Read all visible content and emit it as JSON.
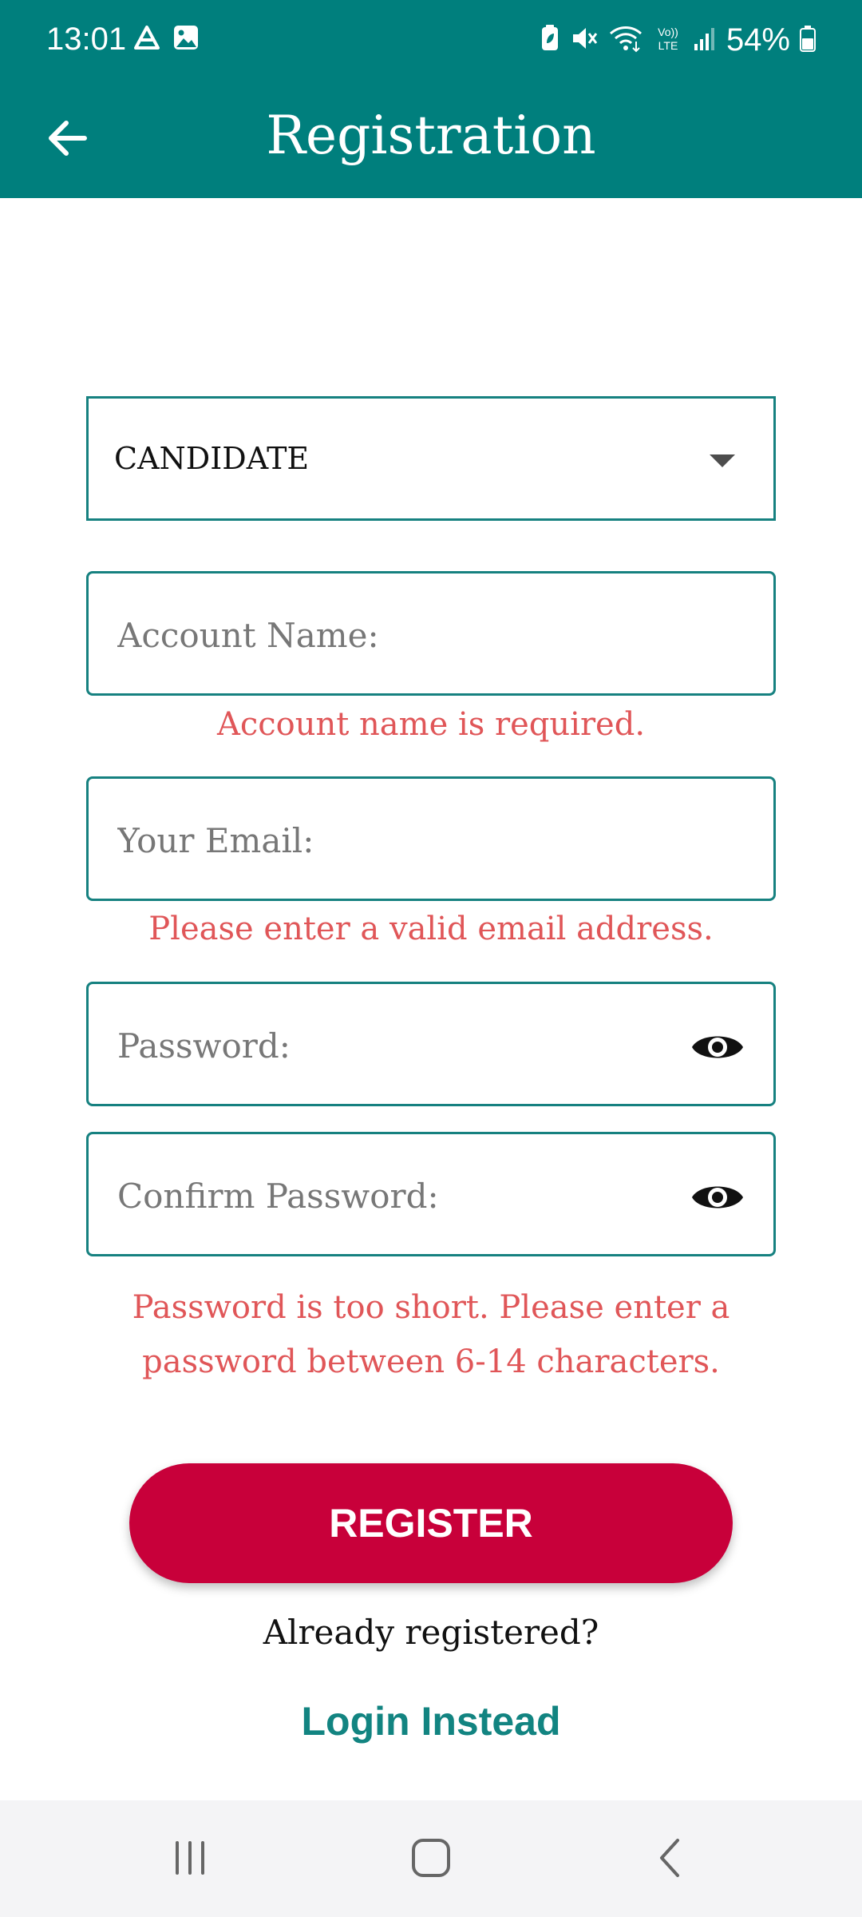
{
  "status_bar": {
    "time": "13:01",
    "battery": "54%",
    "icons": [
      "drive-icon",
      "image-icon",
      "battery-saver-icon",
      "mute-icon",
      "wifi-icon",
      "volte-icon",
      "signal-icon",
      "battery-icon"
    ]
  },
  "app_bar": {
    "title": "Registration",
    "back_icon": "back-arrow-icon"
  },
  "form": {
    "account_type": {
      "value": "CANDIDATE",
      "icon": "dropdown-caret-icon"
    },
    "account_name": {
      "placeholder": "Account Name:",
      "error": "Account name is required."
    },
    "email": {
      "placeholder": "Your Email:",
      "error": "Please enter a valid email address."
    },
    "password": {
      "placeholder": "Password:",
      "icon": "eye-icon"
    },
    "confirm_password": {
      "placeholder": "Confirm Password:",
      "icon": "eye-icon"
    },
    "password_error_line1": "Password is too short. Please enter a",
    "password_error_line2": "password between 6-14 characters."
  },
  "actions": {
    "register": "REGISTER",
    "already_registered": "Already registered?",
    "login_instead": "Login Instead"
  },
  "colors": {
    "primary_teal": "#007f7d",
    "field_border": "#168180",
    "error_text": "#e05658",
    "register_button": "#c8003a",
    "login_link": "#128481"
  },
  "nav_bar": {
    "icons": [
      "recent-apps-icon",
      "home-icon",
      "back-icon"
    ]
  }
}
